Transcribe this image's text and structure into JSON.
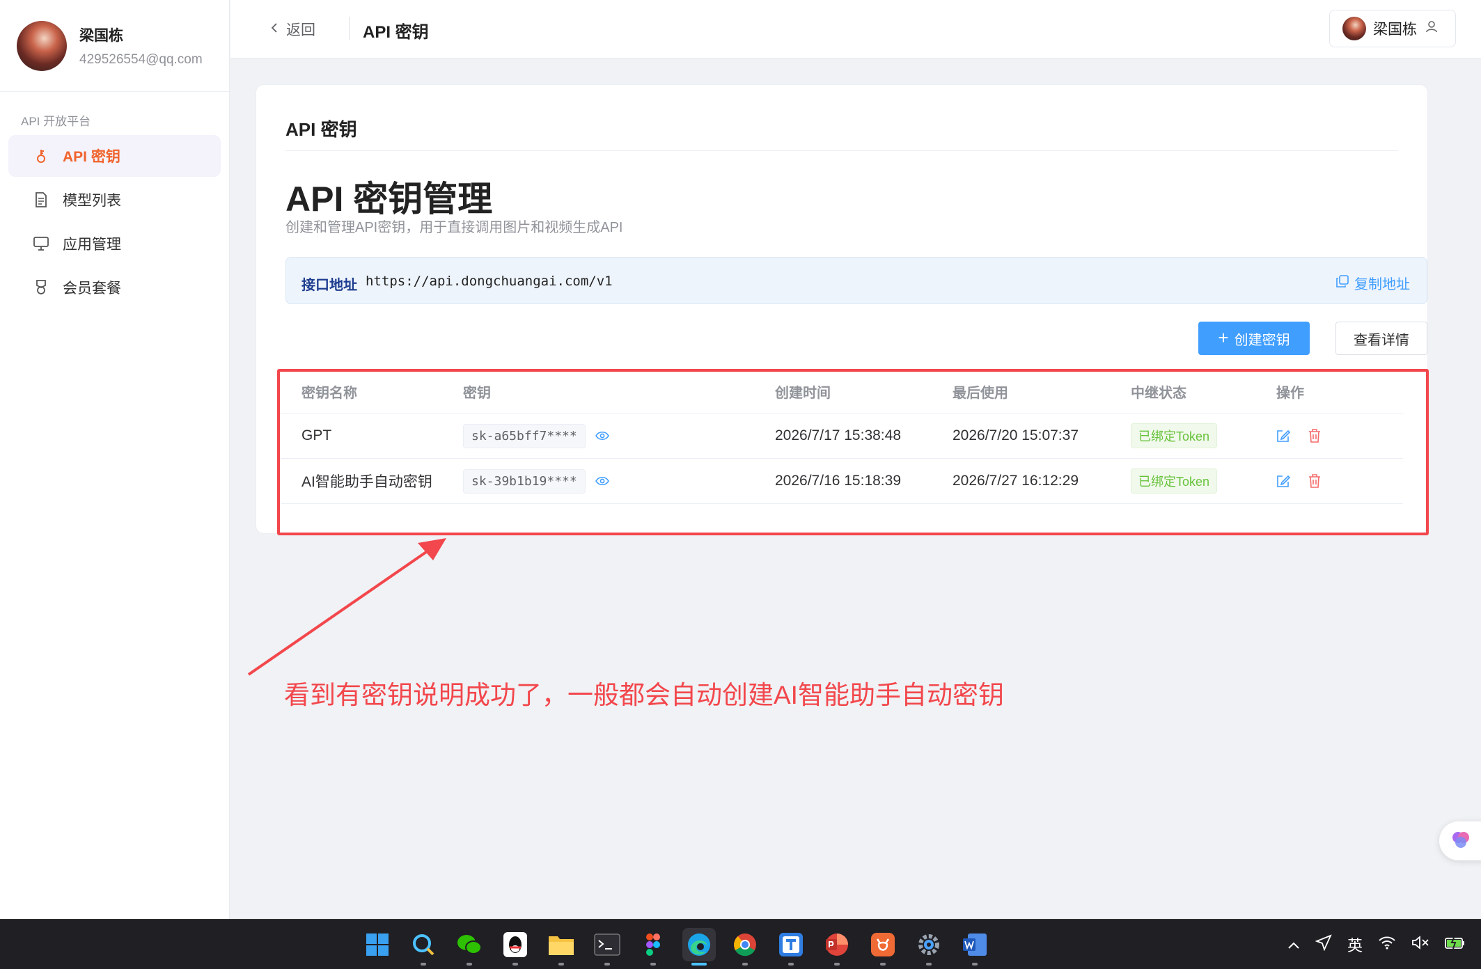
{
  "user": {
    "name": "梁国栋",
    "email": "429526554@qq.com"
  },
  "sidebar": {
    "section_title": "API 开放平台",
    "items": [
      {
        "label": "API 密钥",
        "icon": "key-icon",
        "active": true
      },
      {
        "label": "模型列表",
        "icon": "document-icon",
        "active": false
      },
      {
        "label": "应用管理",
        "icon": "monitor-icon",
        "active": false
      },
      {
        "label": "会员套餐",
        "icon": "medal-icon",
        "active": false
      }
    ]
  },
  "header": {
    "back_label": "返回",
    "title": "API 密钥",
    "user_name": "梁国栋"
  },
  "card": {
    "title": "API 密钥",
    "heading": "API 密钥管理",
    "description": "创建和管理API密钥，用于直接调用图片和视频生成API",
    "endpoint_label": "接口地址",
    "endpoint_url": "https://api.dongchuangai.com/v1",
    "copy_label": "复制地址",
    "create_label": "创建密钥",
    "detail_label": "查看详情"
  },
  "table": {
    "columns": [
      "密钥名称",
      "密钥",
      "创建时间",
      "最后使用",
      "中继状态",
      "操作"
    ],
    "rows": [
      {
        "name": "GPT",
        "key": "sk-a65bff7****",
        "created": "2026/7/17 15:38:48",
        "last_used": "2026/7/20 15:07:37",
        "status": "已绑定Token"
      },
      {
        "name": "AI智能助手自动密钥",
        "key": "sk-39b1b19****",
        "created": "2026/7/16 15:18:39",
        "last_used": "2026/7/27 16:12:29",
        "status": "已绑定Token"
      }
    ]
  },
  "annotation": {
    "text": "看到有密钥说明成功了，一般都会自动创建AI智能助手自动密钥",
    "color": "#f2474c"
  },
  "colors": {
    "accent": "#f0642d",
    "primary": "#409eff",
    "success": "#67c23a",
    "danger": "#f56c6c"
  },
  "taskbar": {
    "apps": [
      "windows-start-icon",
      "search-icon",
      "wechat-icon",
      "qq-icon",
      "file-explorer-icon",
      "terminal-icon",
      "figma-icon",
      "edge-icon",
      "chrome-icon",
      "translator-icon",
      "powerpoint-icon",
      "lobster-app-icon",
      "settings-icon",
      "word-icon"
    ],
    "ime": "英"
  }
}
